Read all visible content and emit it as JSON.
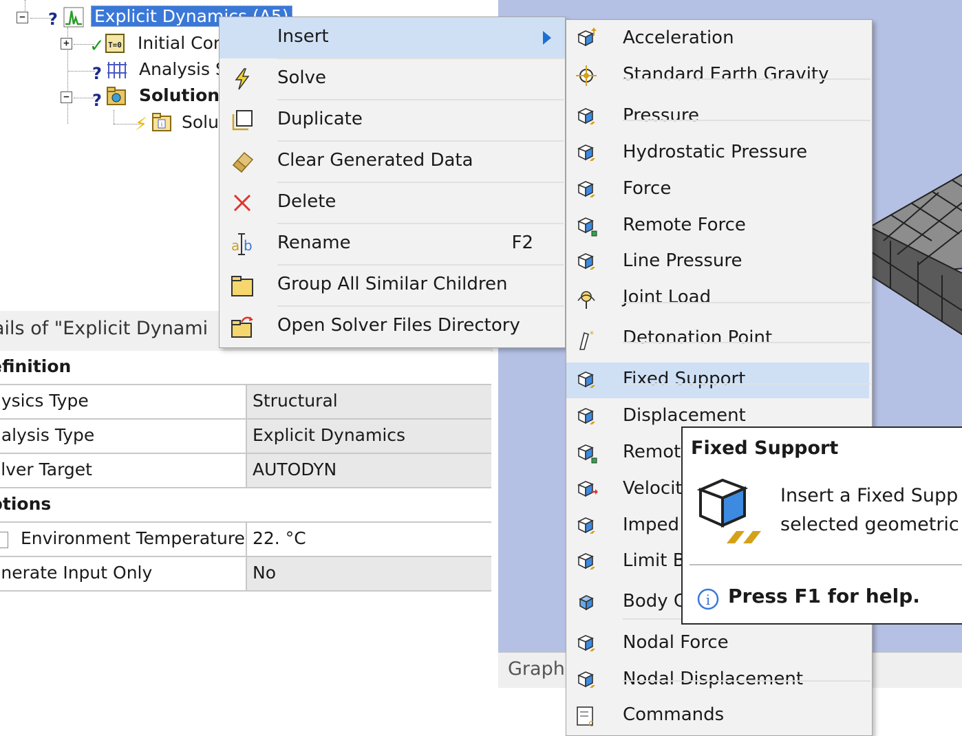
{
  "tree": {
    "root_label": "Explicit Dynamics (A5)",
    "items": [
      {
        "label": "Initial Con",
        "status": "check"
      },
      {
        "label": "Analysis S",
        "status": "question"
      },
      {
        "label": "Solution",
        "status": "question"
      },
      {
        "label": "Solu",
        "status": "lightning"
      }
    ]
  },
  "details": {
    "title": "ails of \"Explicit Dynami",
    "sections": {
      "definition": "efinition",
      "options": "ptions"
    },
    "rows": [
      {
        "key": "hysics Type",
        "value": "Structural"
      },
      {
        "key": "nalysis Type",
        "value": "Explicit Dynamics"
      },
      {
        "key": "olver Target",
        "value": "AUTODYN"
      },
      {
        "key": "Environment Temperature",
        "value": "22. °C"
      },
      {
        "key": "enerate Input Only",
        "value": "No"
      }
    ]
  },
  "context_menu": {
    "items": [
      {
        "label": "Insert",
        "icon": "none",
        "shortcut": ""
      },
      {
        "label": "Solve",
        "icon": "solve-icon",
        "shortcut": ""
      },
      {
        "label": "Duplicate",
        "icon": "duplicate-icon",
        "shortcut": ""
      },
      {
        "label": "Clear Generated Data",
        "icon": "eraser-icon",
        "shortcut": ""
      },
      {
        "label": "Delete",
        "icon": "delete-icon",
        "shortcut": ""
      },
      {
        "label": "Rename",
        "icon": "rename-icon",
        "shortcut": "F2"
      },
      {
        "label": "Group All Similar Children",
        "icon": "folder-icon",
        "shortcut": ""
      },
      {
        "label": "Open Solver Files Directory",
        "icon": "open-folder-icon",
        "shortcut": ""
      }
    ]
  },
  "insert_submenu": {
    "items": [
      {
        "label": "Acceleration"
      },
      {
        "label": "Standard Earth Gravity"
      },
      {
        "label": "Pressure"
      },
      {
        "label": "Hydrostatic Pressure"
      },
      {
        "label": "Force"
      },
      {
        "label": "Remote Force"
      },
      {
        "label": "Line Pressure"
      },
      {
        "label": "Joint Load"
      },
      {
        "label": "Detonation Point"
      },
      {
        "label": "Fixed Support"
      },
      {
        "label": "Displacement"
      },
      {
        "label": "Remot"
      },
      {
        "label": "Velocit"
      },
      {
        "label": "Imped"
      },
      {
        "label": "Limit B"
      },
      {
        "label": "Body C"
      },
      {
        "label": "Nodal Force"
      },
      {
        "label": "Nodal Displacement"
      },
      {
        "label": "Commands"
      }
    ]
  },
  "tooltip": {
    "title": "Fixed Support",
    "line1": "Insert a Fixed Supp",
    "line2": "selected geometric",
    "help": "Press F1 for help."
  },
  "viewport": {
    "graph_label": "Graph"
  },
  "colors": {
    "selection": "#3a78d8",
    "menu_highlight": "#cfe0f5",
    "viewport_bg": "#b5c1e4",
    "delete_red": "#e0332b"
  }
}
